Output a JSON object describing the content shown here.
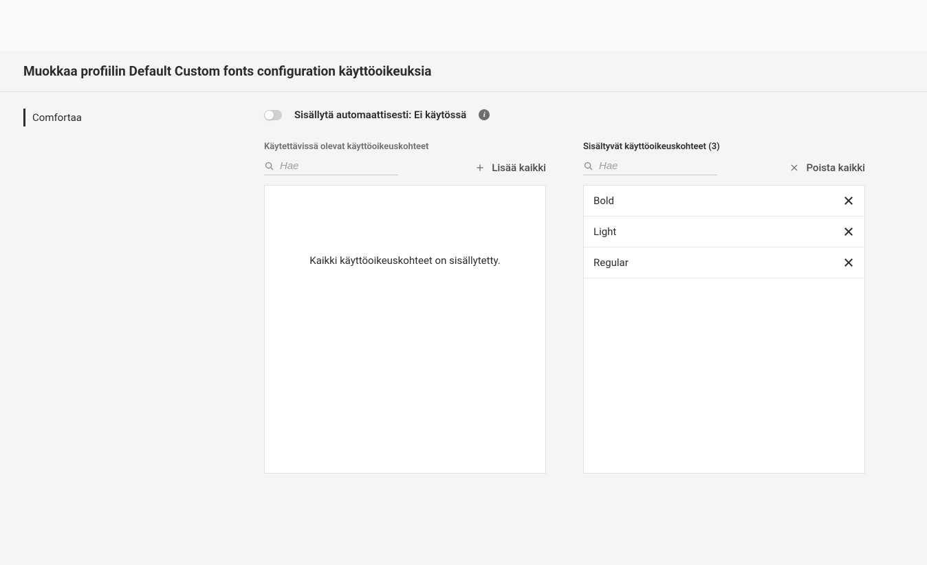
{
  "header": {
    "title": "Muokkaa profiilin Default Custom fonts configuration käyttöoikeuksia"
  },
  "sidebar": {
    "items": [
      {
        "label": "Comfortaa"
      }
    ]
  },
  "toggle": {
    "label": "Sisällytä automaattisesti: Ei käytössä",
    "enabled": false
  },
  "available": {
    "title": "Käytettävissä olevat käyttöoikeuskohteet",
    "search_placeholder": "Hae",
    "add_all_label": "Lisää kaikki",
    "empty_message": "Kaikki käyttöoikeuskohteet on sisällytetty."
  },
  "included": {
    "title_base": "Sisältyvät käyttöoikeuskohteet",
    "count": 3,
    "search_placeholder": "Hae",
    "remove_all_label": "Poista kaikki",
    "items": [
      {
        "label": "Bold"
      },
      {
        "label": "Light"
      },
      {
        "label": "Regular"
      }
    ]
  }
}
